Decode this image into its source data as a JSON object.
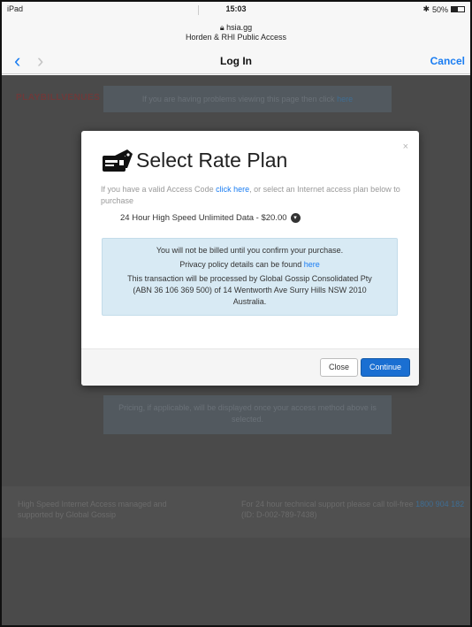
{
  "status_bar": {
    "device": "iPad",
    "time": "15:03",
    "battery": "50%",
    "battery_level": 0.5,
    "bluetooth_icon": "bluetooth-icon"
  },
  "browser": {
    "domain": "hsia.gg",
    "site_name": "Horden & RHI Public Access",
    "page_title": "Log In",
    "cancel_label": "Cancel",
    "accent_color": "#1a7df2"
  },
  "page": {
    "logo_text": "PLAYBILLVENUES",
    "banner_text": "If you are having problems viewing this page then click",
    "banner_link": "here",
    "pricing_text": "Pricing, if applicable, will be displayed once your access method above is selected.",
    "footer_left": "High Speed Internet Access managed and supported by Global Gossip",
    "footer_right_text": "For 24 hour technical support please call toll-free",
    "footer_right_phone": "1800 904 182",
    "footer_right_id": "(ID: D-002-789-7438)"
  },
  "modal": {
    "title": "Select Rate Plan",
    "close_x": "×",
    "intro_prefix": "If you have a valid Access Code",
    "intro_link": "click here",
    "intro_suffix": ", or select an Internet access plan below to purchase",
    "plan_label": "24 Hour High Speed Unlimited Data - $20.00",
    "info": {
      "line1": "You will not be billed until you confirm your purchase.",
      "line2_prefix": "Privacy policy details can be found",
      "line2_link": "here",
      "line3": "This transaction will be processed by Global Gossip Consolidated Pty (ABN 36 106 369 500) of 14 Wentworth Ave Surry Hills NSW 2010 Australia."
    },
    "close_label": "Close",
    "continue_label": "Continue",
    "continue_color": "#1a6fd2"
  }
}
